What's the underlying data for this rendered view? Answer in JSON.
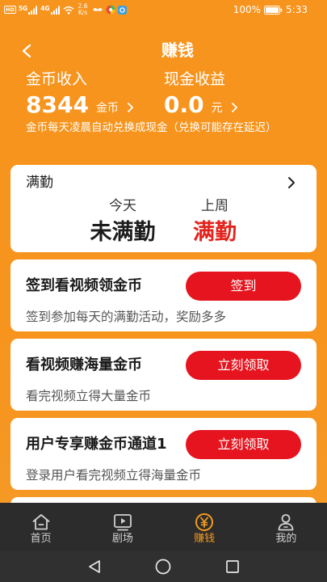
{
  "status_bar": {
    "hd_badge": "HD",
    "sim1_network": "5G",
    "sim2_network": "4G",
    "speed_value": "2.6",
    "speed_unit": "K/s",
    "battery_percent": "100%",
    "time": "5:33"
  },
  "header": {
    "title": "赚钱",
    "back_icon": "chevron-left-icon"
  },
  "earnings": {
    "coins": {
      "label": "金币收入",
      "value": "8344",
      "unit": "金币"
    },
    "cash": {
      "label": "现金收益",
      "value": "0.0",
      "unit": "元"
    },
    "note": "金币每天凌晨自动兑换成现金（兑换可能存在延迟）"
  },
  "attendance": {
    "title": "满勤",
    "today": {
      "label": "今天",
      "status": "未满勤"
    },
    "last_week": {
      "label": "上周",
      "status": "满勤"
    }
  },
  "tasks": [
    {
      "title": "签到看视频领金币",
      "button": "签到",
      "description": "签到参加每天的满勤活动，奖励多多"
    },
    {
      "title": "看视频赚海量金币",
      "button": "立刻领取",
      "description": "看完视频立得大量金币"
    },
    {
      "title": "用户专享赚金币通道1",
      "button": "立刻领取",
      "description": "登录用户看完视频立得海量金币"
    }
  ],
  "tab_bar": {
    "items": [
      {
        "label": "首页",
        "icon": "home-icon"
      },
      {
        "label": "剧场",
        "icon": "play-screen-icon"
      },
      {
        "label": "赚钱",
        "icon": "yen-coin-icon",
        "active": true
      },
      {
        "label": "我的",
        "icon": "user-icon"
      }
    ]
  },
  "system_nav": {
    "icons": [
      "back-triangle-icon",
      "home-circle-icon",
      "recents-square-icon"
    ]
  },
  "colors": {
    "background_orange": "#F7941D",
    "button_red": "#E5141E",
    "highlight_red": "#E3231C",
    "tab_active_orange": "#F39A1E",
    "tab_bar_dark": "#2C2C2C"
  }
}
